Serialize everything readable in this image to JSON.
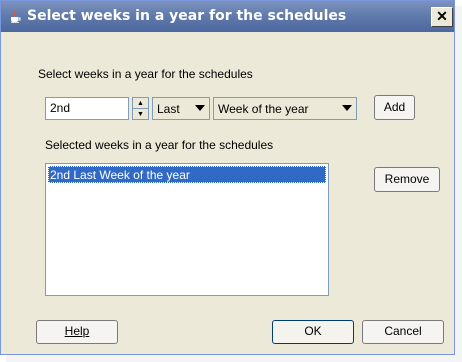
{
  "window": {
    "title": "Select weeks in a year for the schedules",
    "close_glyph": "✕"
  },
  "form": {
    "section_label": "Select weeks in a year for the schedules",
    "ordinal_value": "2nd",
    "position_value": "Last",
    "unit_value": "Week of the year",
    "add_label": "Add",
    "selected_label": "Selected weeks in a year for the schedules",
    "selected_items": [
      "2nd Last Week of the year"
    ],
    "remove_label": "Remove"
  },
  "footer": {
    "help_label": "Help",
    "ok_label": "OK",
    "cancel_label": "Cancel"
  }
}
